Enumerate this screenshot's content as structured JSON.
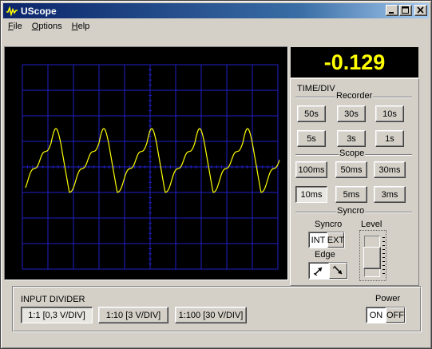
{
  "window": {
    "title": "UScope"
  },
  "menu": [
    {
      "label": "File",
      "accel": "F",
      "rest": "ile"
    },
    {
      "label": "Options",
      "accel": "O",
      "rest": "ptions"
    },
    {
      "label": "Help",
      "accel": "H",
      "rest": "elp"
    }
  ],
  "readout": {
    "value": "-0.129",
    "color": "#ffff00"
  },
  "timediv": {
    "label": "TIME/DIV",
    "recorder": {
      "label": "Recorder",
      "buttons": [
        "50s",
        "30s",
        "10s",
        "5s",
        "3s",
        "1s"
      ]
    },
    "scope": {
      "label": "Scope",
      "buttons": [
        "100ms",
        "50ms",
        "30ms",
        "10ms",
        "5ms",
        "3ms"
      ],
      "selected": "10ms"
    }
  },
  "syncro": {
    "label": "Syncro",
    "mode_label": "Syncro",
    "int": "INT",
    "ext": "EXT",
    "selected": "INT",
    "edge_label": "Edge",
    "edge_rising_icon": "rising-edge-icon",
    "edge_falling_icon": "falling-edge-icon",
    "level_label": "Level",
    "level": 0.45
  },
  "input_divider": {
    "label": "INPUT DIVIDER",
    "buttons": [
      "1:1 [0,3 V/DIV]",
      "1:10 [3 V/DIV]",
      "1:100 [30 V/DIV]"
    ],
    "selected": "1:1 [0,3 V/DIV]"
  },
  "power": {
    "label": "Power",
    "on": "ON",
    "off": "OFF",
    "state": "ON"
  },
  "colors": {
    "grid": "#2020c8",
    "trace": "#ffff00",
    "screen": "#000000",
    "face": "#d4d0c8"
  }
}
